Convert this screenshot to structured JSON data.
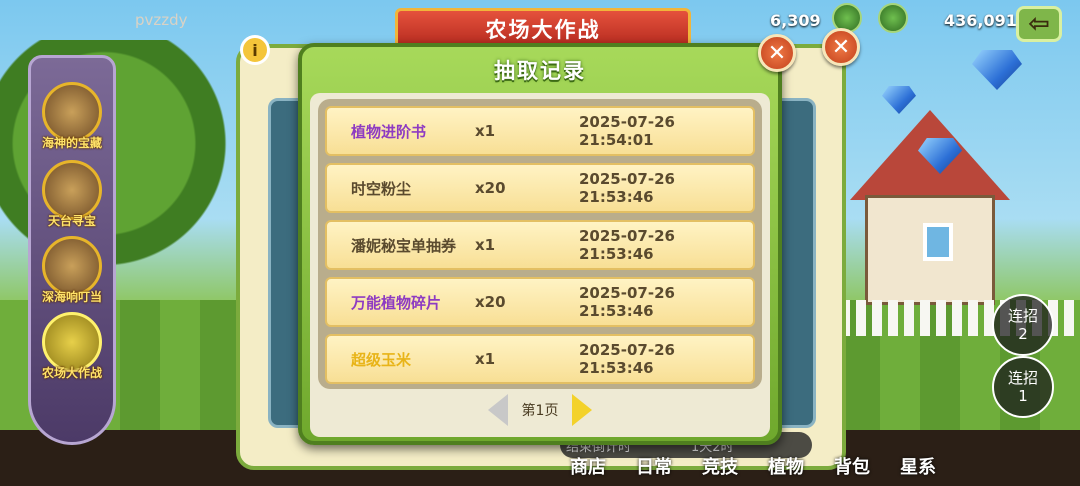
{
  "header": {
    "player_name": "pvzzdy",
    "currency_a": "6,309",
    "currency_b": "436,091",
    "title": "农场大作战",
    "back_icon": "arrow-left-icon"
  },
  "events": [
    {
      "label": "海神的宝藏"
    },
    {
      "label": "天台寻宝"
    },
    {
      "label": "深海响叮当"
    },
    {
      "label": "农场大作战"
    }
  ],
  "dialog": {
    "title": "抽取记录",
    "close_icon": "close-icon",
    "records": [
      {
        "name": "植物进阶书",
        "qty": "x1",
        "time": "2025-07-26 21:54:01",
        "color": "#8e3bc2"
      },
      {
        "name": "时空粉尘",
        "qty": "x20",
        "time": "2025-07-26 21:53:46",
        "color": "#5a4a2e"
      },
      {
        "name": "潘妮秘宝单抽券",
        "qty": "x1",
        "time": "2025-07-26 21:53:46",
        "color": "#5a4a2e"
      },
      {
        "name": "万能植物碎片",
        "qty": "x20",
        "time": "2025-07-26 21:53:46",
        "color": "#8e3bc2"
      },
      {
        "name": "超级玉米",
        "qty": "x1",
        "time": "2025-07-26 21:53:46",
        "color": "#e8b418"
      }
    ],
    "page_label": "第1页"
  },
  "combos": [
    {
      "label": "连招",
      "count": "2"
    },
    {
      "label": "连招",
      "count": "1"
    }
  ],
  "background": {
    "end_time_label": "结束倒计时",
    "end_time_value": "1天2时"
  },
  "bottom_nav": [
    "商店",
    "日常",
    "竞技",
    "植物",
    "背包",
    "星系"
  ]
}
